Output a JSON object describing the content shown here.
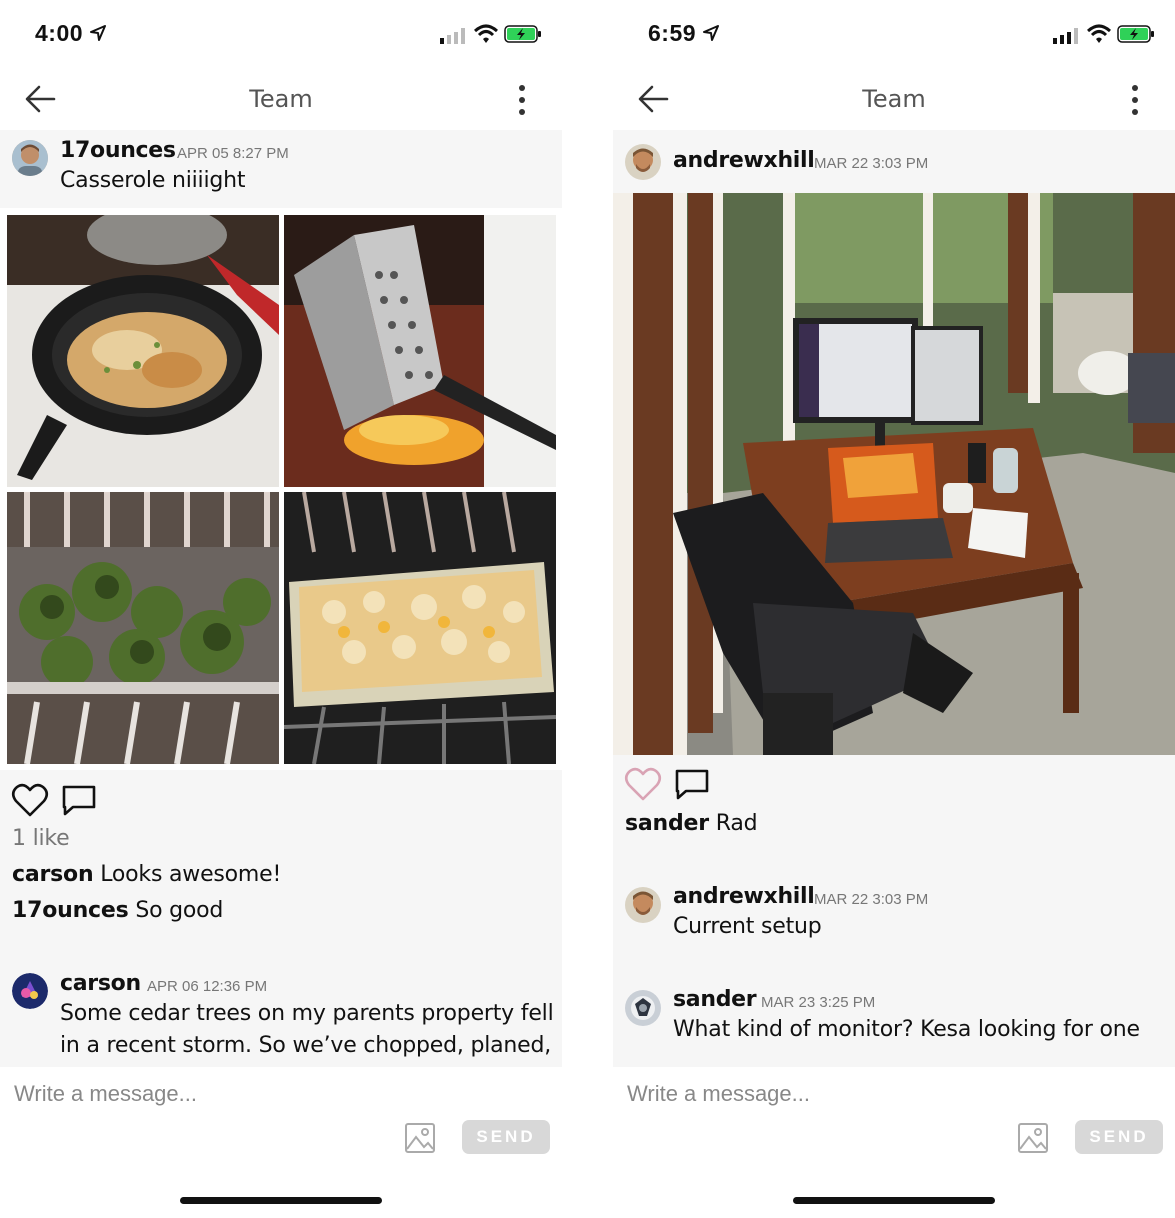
{
  "left": {
    "status": {
      "time": "4:00"
    },
    "nav": {
      "title": "Team"
    },
    "post1": {
      "username": "17ounces",
      "timestamp": "APR 05 8:27 PM",
      "text": "Casserole niiiight",
      "likes": "1 like",
      "comments": [
        {
          "user": "carson",
          "text": "Looks awesome!"
        },
        {
          "user": "17ounces",
          "text": "So good"
        }
      ]
    },
    "post2": {
      "username": "carson",
      "timestamp": "APR 06 12:36 PM",
      "line1": "Some cedar trees on my parents property fell",
      "line2": "in a recent storm. So we’ve chopped, planed,"
    },
    "composer": {
      "placeholder": "Write a message...",
      "send_label": "SEND"
    }
  },
  "right": {
    "status": {
      "time": "6:59"
    },
    "nav": {
      "title": "Team"
    },
    "post1": {
      "username": "andrewxhill",
      "timestamp": "MAR 22 3:03 PM",
      "comments": [
        {
          "user": "sander",
          "text": "Rad"
        }
      ]
    },
    "post2": {
      "username": "andrewxhill",
      "timestamp": "MAR 22 3:03 PM",
      "text": "Current setup"
    },
    "post3": {
      "username": "sander",
      "timestamp": "MAR 23 3:25 PM",
      "text": "What kind of monitor? Kesa looking for one"
    },
    "composer": {
      "placeholder": "Write a message...",
      "send_label": "SEND"
    }
  },
  "colors": {
    "heart_liked_outline": "#d9a3b4",
    "battery_green": "#2fd158",
    "send_disabled": "#d8d8d8"
  },
  "icons": [
    "location-arrow-icon",
    "signal-icon",
    "wifi-icon",
    "battery-icon",
    "back-arrow-icon",
    "more-vertical-icon",
    "heart-icon",
    "comment-icon",
    "image-icon"
  ]
}
